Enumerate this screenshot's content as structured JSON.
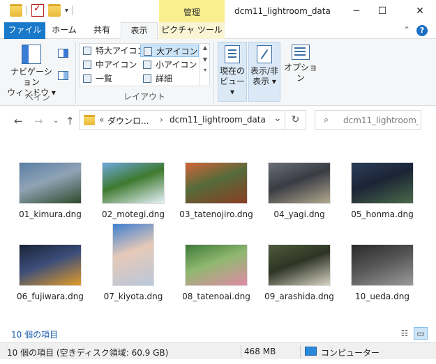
{
  "window": {
    "title": "dcm11_lightroom_data",
    "context_tab_title": "管理",
    "minimize": "─",
    "maximize": "☐",
    "close": "✕"
  },
  "ribbon_tabs": {
    "file": "ファイル",
    "home": "ホーム",
    "share": "共有",
    "view": "表示",
    "picture_tools": "ピクチャ ツール",
    "collapse": "⌃",
    "help": "?"
  },
  "ribbon": {
    "pane_group": {
      "nav_pane_line1": "ナビゲーション",
      "nav_pane_line2": "ウィンドウ ▾",
      "label": "ペイン"
    },
    "layout_group": {
      "items": [
        "特大アイコン",
        "大アイコン",
        "中アイコン",
        "小アイコン",
        "一覧",
        "詳細"
      ],
      "selected": "大アイコン",
      "label": "レイアウト"
    },
    "current_view": {
      "line1": "現在の",
      "line2": "ビュー ▾"
    },
    "show_hide": {
      "line1": "表示/非",
      "line2": "表示 ▾"
    },
    "options": "オプション"
  },
  "address": {
    "prefix": "«",
    "crumb1": "ダウンロ...",
    "separator": "›",
    "crumb2": "dcm11_lightroom_data",
    "dropdown": "⌄",
    "refresh": "↻"
  },
  "search": {
    "placeholder": "dcm11_lightroom_..."
  },
  "files": [
    {
      "name": "01_kimura.dng",
      "colors": [
        "#5b7fa6",
        "#2f4a2c",
        "#8fa3b5"
      ],
      "orientation": "landscape"
    },
    {
      "name": "02_motegi.dng",
      "colors": [
        "#6fa8e0",
        "#e8f2fb",
        "#3e7a2e"
      ],
      "orientation": "landscape"
    },
    {
      "name": "03_tatenojiro.dng",
      "colors": [
        "#d2653a",
        "#8a3e24",
        "#556b3a"
      ],
      "orientation": "landscape"
    },
    {
      "name": "04_yagi.dng",
      "colors": [
        "#6d6f78",
        "#b3a98f",
        "#3a3c44"
      ],
      "orientation": "landscape"
    },
    {
      "name": "05_honma.dng",
      "colors": [
        "#2c3e5a",
        "#4a6a4a",
        "#1b2435"
      ],
      "orientation": "landscape"
    },
    {
      "name": "06_fujiwara.dng",
      "colors": [
        "#1a2238",
        "#e39a2a",
        "#3b4e7a"
      ],
      "orientation": "landscape"
    },
    {
      "name": "07_kiyota.dng",
      "colors": [
        "#3f7fd0",
        "#b9c8db",
        "#e6c9b8"
      ],
      "orientation": "portrait"
    },
    {
      "name": "08_tatenoai.dng",
      "colors": [
        "#3f7a3a",
        "#e08aa5",
        "#90b870"
      ],
      "orientation": "landscape"
    },
    {
      "name": "09_arashida.dng",
      "colors": [
        "#4f5a3a",
        "#d7d3c5",
        "#2e3424"
      ],
      "orientation": "landscape"
    },
    {
      "name": "10_ueda.dng",
      "colors": [
        "#2a2a2a",
        "#9a9a9a",
        "#555555"
      ],
      "orientation": "landscape"
    }
  ],
  "content_footer": {
    "item_count": "10 個の項目"
  },
  "status": {
    "summary": "10 個の項目 (空きディスク領域: 60.9 GB)",
    "size": "468 MB",
    "location": "コンピューター"
  }
}
